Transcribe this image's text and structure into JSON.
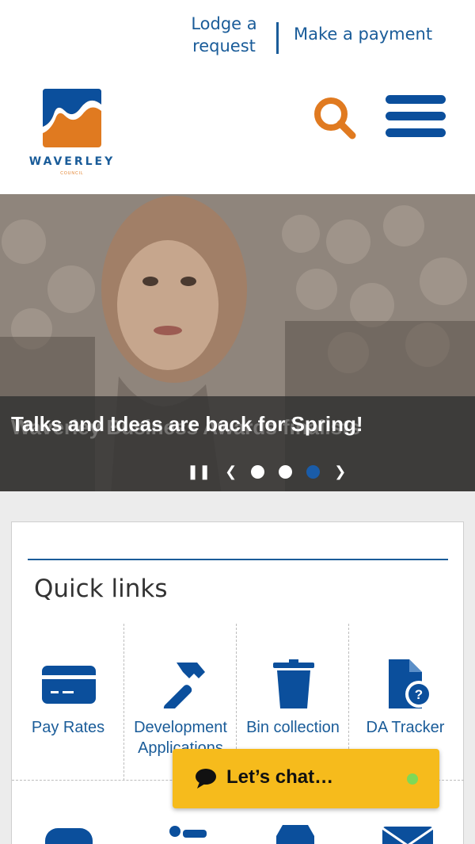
{
  "header": {
    "lodge_label": "Lodge a request",
    "pay_label": "Make a payment",
    "logo_name": "WAVERLEY",
    "logo_sub": "COUNCIL"
  },
  "hero": {
    "title": "Talks and Ideas are back for Spring!",
    "previous_title": "Waverley Business Awards finalists",
    "slide_count": 3,
    "active_slide": 3
  },
  "quick_links": {
    "title": "Quick links",
    "items": [
      {
        "label": "Pay Rates",
        "icon": "credit-card-icon"
      },
      {
        "label": "Development Applications",
        "icon": "hammer-icon"
      },
      {
        "label": "Bin collection",
        "icon": "bin-icon"
      },
      {
        "label": "DA Tracker",
        "icon": "document-question-icon"
      }
    ]
  },
  "chat": {
    "label": "Let’s chat…",
    "status_color": "#7ed957"
  },
  "colors": {
    "brand_blue": "#1a5c99",
    "brand_orange": "#e07a20",
    "chat_yellow": "#f6bb1c"
  }
}
